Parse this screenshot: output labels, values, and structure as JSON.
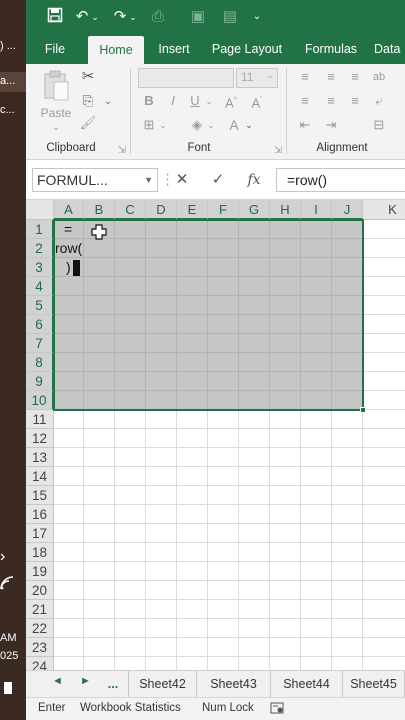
{
  "taskbar": {
    "line1": ") ...",
    "line2": "a...",
    "line3": "c...",
    "time": "AM",
    "year": "025"
  },
  "tabs": [
    {
      "label": "File"
    },
    {
      "label": "Home"
    },
    {
      "label": "Insert"
    },
    {
      "label": "Page Layout"
    },
    {
      "label": "Formulas"
    },
    {
      "label": "Data"
    }
  ],
  "ribbon": {
    "paste_label": "Paste",
    "font_size": "11",
    "groups": {
      "clipboard": "Clipboard",
      "font": "Font",
      "alignment": "Alignment"
    }
  },
  "formula_bar": {
    "name_box": "FORMUL...",
    "fx_label": "fx",
    "formula": "=row()"
  },
  "grid": {
    "columns": [
      "A",
      "B",
      "C",
      "D",
      "E",
      "F",
      "G",
      "H",
      "I",
      "J",
      "K"
    ],
    "rows": [
      "1",
      "2",
      "3",
      "4",
      "5",
      "6",
      "7",
      "8",
      "9",
      "10",
      "11",
      "12",
      "13",
      "14",
      "15",
      "16",
      "17",
      "18",
      "19",
      "20",
      "21",
      "22",
      "23",
      "24"
    ],
    "edit_text": {
      "line1": "=",
      "line2": "row(",
      "line3": ")"
    }
  },
  "sheets": {
    "ellipsis": "...",
    "tabs": [
      "Sheet42",
      "Sheet43",
      "Sheet44",
      "Sheet45"
    ]
  },
  "status": {
    "mode": "Enter",
    "workbook_stats": "Workbook Statistics",
    "num_lock": "Num Lock"
  },
  "colors": {
    "accent": "#217346",
    "selection_fill": "#c6c6c6"
  }
}
